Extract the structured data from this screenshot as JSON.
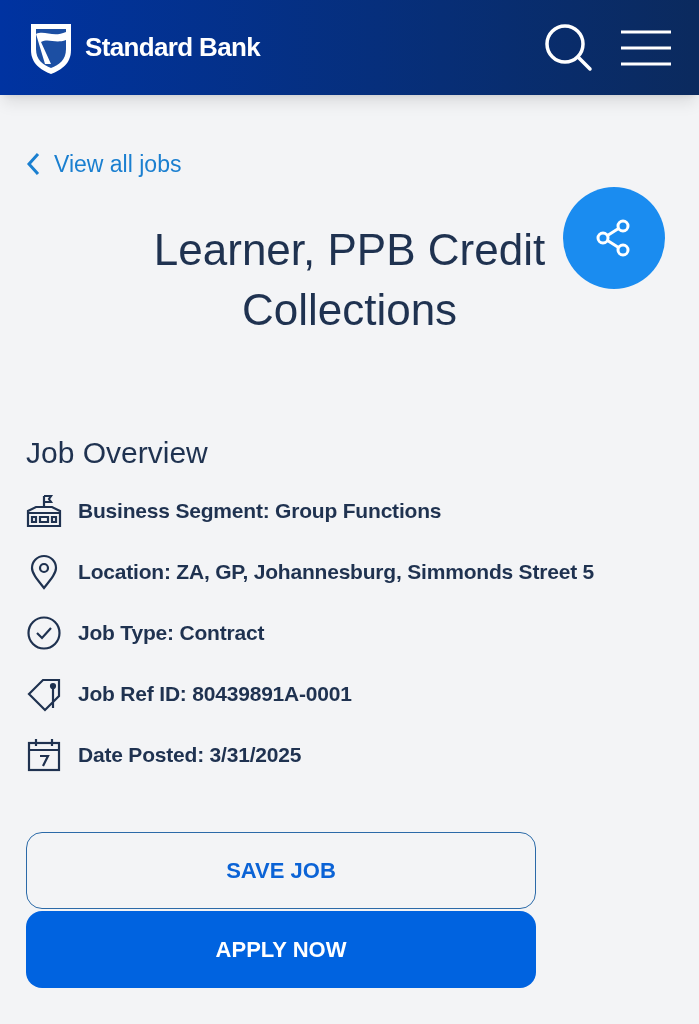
{
  "header": {
    "brand": "Standard Bank"
  },
  "back_link": {
    "label": "View all jobs"
  },
  "job_title": "Learner, PPB Credit Collections",
  "overview": {
    "heading": "Job Overview",
    "items": [
      {
        "kind": "building",
        "text": "Business Segment: Group Functions"
      },
      {
        "kind": "location",
        "text": "Location: ZA, GP, Johannesburg, Simmonds Street 5"
      },
      {
        "kind": "type",
        "text": "Job Type: Contract"
      },
      {
        "kind": "tag",
        "text": "Job Ref ID: 80439891A-0001"
      },
      {
        "kind": "calendar",
        "text": "Date Posted: 3/31/2025"
      }
    ]
  },
  "buttons": [
    {
      "kind": "outline",
      "label": "SAVE JOB"
    },
    {
      "kind": "filled",
      "label": "APPLY NOW"
    }
  ]
}
